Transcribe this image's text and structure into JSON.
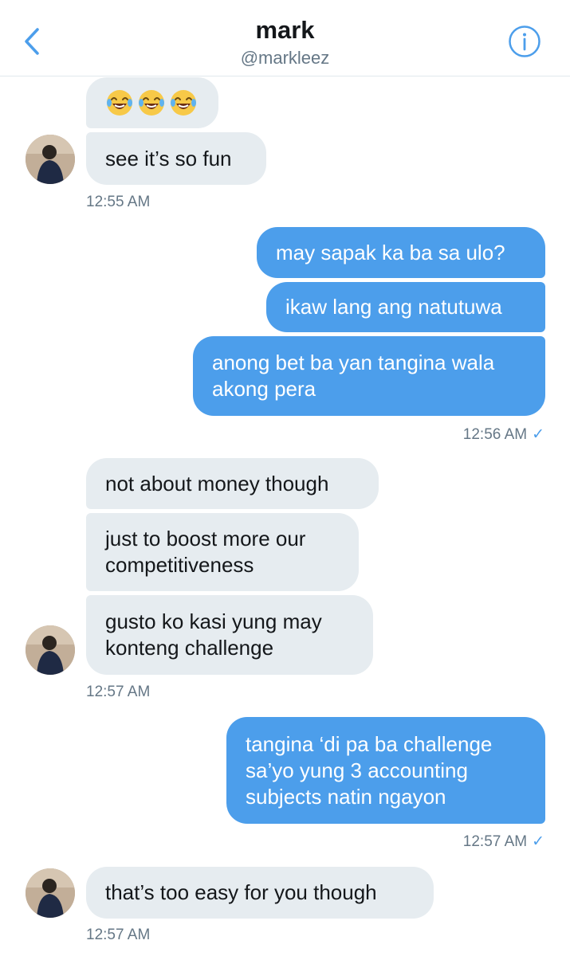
{
  "header": {
    "name": "mark",
    "handle": "@markleez"
  },
  "icons": {
    "back": "chevron-left-icon",
    "info": "info-circle-icon",
    "read_receipt": "checkmark-icon",
    "emoji": "face-with-tears-of-joy"
  },
  "colors": {
    "accent": "#4c9eeb",
    "incoming_bubble": "#e6ecf0",
    "timestamp": "#657786"
  },
  "messages": {
    "m1_emoji_count": 3,
    "m2": "see it’s so fun",
    "t1": "12:55 AM",
    "m3": "may sapak ka ba sa ulo?",
    "m4": "ikaw lang ang natutuwa",
    "m5": "anong bet ba yan tangina wala akong pera",
    "t2": "12:56 AM",
    "t2_check": "✓",
    "m6": "not about money though",
    "m7": "just to boost more our competitiveness",
    "m8": "gusto ko kasi yung may konteng challenge",
    "t3": "12:57 AM",
    "m9": "tangina ‘di pa ba challenge sa’yo yung 3 accounting subjects natin ngayon",
    "t4": "12:57 AM",
    "t4_check": "✓",
    "m10": "that’s too easy for you though",
    "t5": "12:57 AM"
  }
}
